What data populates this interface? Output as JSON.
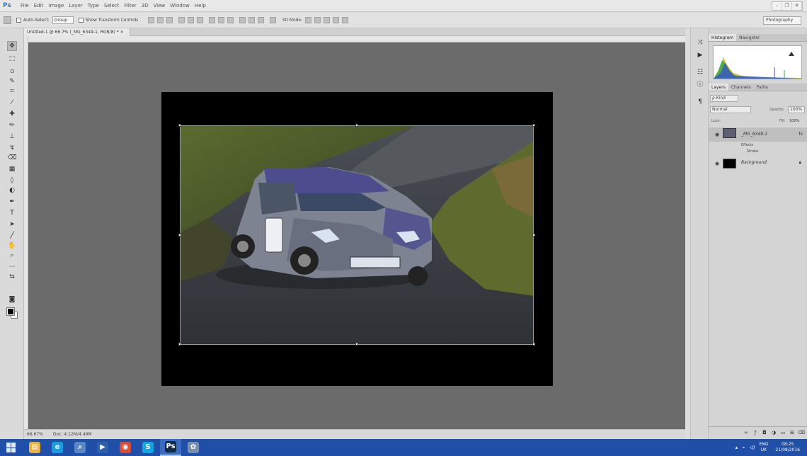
{
  "app": {
    "logo": "Ps",
    "menu": [
      "File",
      "Edit",
      "Image",
      "Layer",
      "Type",
      "Select",
      "Filter",
      "3D",
      "View",
      "Window",
      "Help"
    ],
    "window_controls": [
      "–",
      "❐",
      "✕"
    ]
  },
  "options_bar": {
    "auto_select_label": "Auto-Select:",
    "auto_select_value": "Group",
    "show_transform_label": "Show Transform Controls",
    "mode_3d_label": "3D Mode:",
    "workspace": "Photography"
  },
  "document": {
    "tab_title": "Untitled-1 @ 66.7% (_MG_6349-1, RGB/8) * ×",
    "zoom": "66.67%",
    "doc_info": "Doc: 4.12M/4.49M"
  },
  "panels": {
    "top_tabs": [
      "Histogram",
      "Navigator"
    ],
    "layer_tabs": [
      "Layers",
      "Channels",
      "Paths"
    ],
    "kind_filter": "ρ Kind",
    "blend_mode": "Normal",
    "opacity_label": "Opacity:",
    "opacity": "100%",
    "lock_label": "Lock:",
    "fill_label": "Fill:",
    "fill": "100%",
    "layers": [
      {
        "name": "_MG_6349-1",
        "selected": true
      },
      {
        "name": "Background",
        "selected": false
      }
    ],
    "effects_label": "Effects",
    "stroke_label": "Stroke"
  },
  "statusbar": {
    "zoom": "66.67%",
    "doc": "Doc: 4.12M/4.49M"
  },
  "taskbar": {
    "apps": [
      {
        "icon": "file-explorer-icon",
        "glyph": "▤",
        "color": "#e9b23f"
      },
      {
        "icon": "internet-explorer-icon",
        "glyph": "e",
        "color": "#1d9be0"
      },
      {
        "icon": "search-app-icon",
        "glyph": "⌕",
        "color": "#5a86c9"
      },
      {
        "icon": "media-player-icon",
        "glyph": "▶",
        "color": "#2f5fa8"
      },
      {
        "icon": "chrome-icon",
        "glyph": "◉",
        "color": "#d94b36"
      },
      {
        "icon": "skype-icon",
        "glyph": "S",
        "color": "#1aa3e3"
      },
      {
        "icon": "photoshop-icon",
        "glyph": "Ps",
        "color": "#0d2a4f"
      },
      {
        "icon": "gallery-icon",
        "glyph": "✿",
        "color": "#7a8fb0"
      }
    ],
    "language": "ENG",
    "region": "UK",
    "time": "08:25",
    "date": "21/08/2016"
  }
}
